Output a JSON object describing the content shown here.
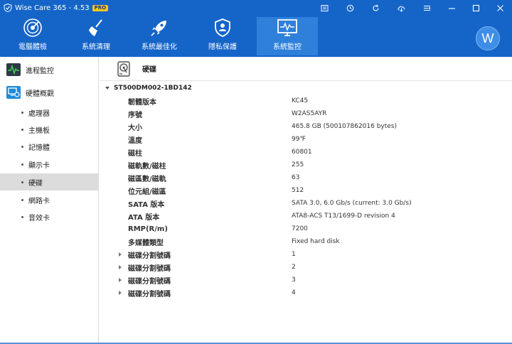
{
  "app": {
    "title": "Wise Care 365 - 4.53",
    "badge": "PRO",
    "accent_color": "#1565c9",
    "active_nav_color": "#2e80db"
  },
  "titlebar": {
    "tools": [
      {
        "name": "message-icon"
      },
      {
        "name": "skin-icon"
      },
      {
        "name": "refresh-icon"
      },
      {
        "name": "cloud-icon"
      },
      {
        "name": "menu-icon"
      }
    ],
    "window_controls": [
      "minimize-icon",
      "maximize-icon",
      "close-icon"
    ]
  },
  "nav": {
    "items": [
      {
        "label": "電腦體檢",
        "icon": "radar-icon",
        "active": false
      },
      {
        "label": "系統清理",
        "icon": "broom-icon",
        "active": false
      },
      {
        "label": "系統最佳化",
        "icon": "rocket-icon",
        "active": false
      },
      {
        "label": "隱私保護",
        "icon": "shield-icon",
        "active": false
      },
      {
        "label": "系統監控",
        "icon": "monitor-icon",
        "active": true
      }
    ],
    "avatar": "W"
  },
  "sidebar": {
    "main_items": [
      {
        "label": "進程監控",
        "icon": "process-monitor-icon"
      },
      {
        "label": "硬體概觀",
        "icon": "hardware-overview-icon"
      }
    ],
    "sub_items": [
      {
        "label": "處理器",
        "active": false
      },
      {
        "label": "主機板",
        "active": false
      },
      {
        "label": "記憶體",
        "active": false
      },
      {
        "label": "顯示卡",
        "active": false
      },
      {
        "label": "硬碟",
        "active": true
      },
      {
        "label": "網路卡",
        "active": false
      },
      {
        "label": "音效卡",
        "active": false
      }
    ]
  },
  "content": {
    "header_title": "硬碟",
    "disk_model": "ST500DM002-1BD142",
    "rows": [
      {
        "label": "韌體版本",
        "value": "KC45",
        "expandable": false
      },
      {
        "label": "序號",
        "value": "W2AS5AYR",
        "expandable": false
      },
      {
        "label": "大小",
        "value": "465.8 GB (500107862016 bytes)",
        "expandable": false
      },
      {
        "label": "溫度",
        "value": "99℉",
        "expandable": false
      },
      {
        "label": "磁柱",
        "value": "60801",
        "expandable": false
      },
      {
        "label": "磁軌數/磁柱",
        "value": "255",
        "expandable": false
      },
      {
        "label": "磁區數/磁軌",
        "value": "63",
        "expandable": false
      },
      {
        "label": "位元組/磁區",
        "value": "512",
        "expandable": false
      },
      {
        "label": "SATA 版本",
        "value": "SATA 3.0, 6.0 Gb/s (current: 3.0 Gb/s)",
        "expandable": false
      },
      {
        "label": "ATA 版本",
        "value": "ATA8-ACS T13/1699-D revision 4",
        "expandable": false
      },
      {
        "label": "RMP(R/m)",
        "value": "7200",
        "expandable": false
      },
      {
        "label": "多媒體類型",
        "value": "Fixed hard disk",
        "expandable": false
      },
      {
        "label": "磁碟分割號碼",
        "value": "1",
        "expandable": true
      },
      {
        "label": "磁碟分割號碼",
        "value": "2",
        "expandable": true
      },
      {
        "label": "磁碟分割號碼",
        "value": "3",
        "expandable": true
      },
      {
        "label": "磁碟分割號碼",
        "value": "4",
        "expandable": true
      }
    ]
  }
}
